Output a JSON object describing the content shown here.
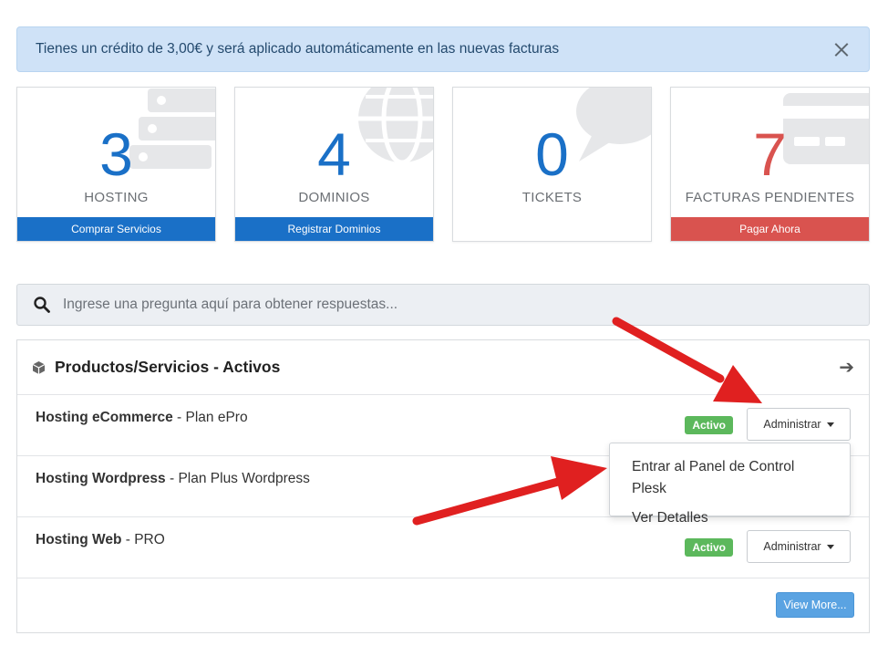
{
  "alert": {
    "text": "Tienes un crédito de 3,00€ y será aplicado automáticamente en las nuevas facturas"
  },
  "tiles": [
    {
      "number": "3",
      "label": "HOSTING",
      "footer": "Comprar Servicios",
      "icon": "server-icon"
    },
    {
      "number": "4",
      "label": "DOMINIOS",
      "footer": "Registrar Dominios",
      "icon": "globe-icon"
    },
    {
      "number": "0",
      "label": "TICKETS",
      "footer": "",
      "icon": "chat-bubble-icon"
    },
    {
      "number": "7",
      "label": "FACTURAS PENDIENTES",
      "footer": "Pagar Ahora",
      "icon": "credit-card-icon"
    }
  ],
  "search": {
    "placeholder": "Ingrese una pregunta aquí para obtener respuestas..."
  },
  "products": {
    "title": "Productos/Servicios - Activos",
    "rows": [
      {
        "product": "Hosting eCommerce",
        "plan": "- Plan ePro",
        "status": "Activo",
        "action": "Administrar"
      },
      {
        "product": "Hosting Wordpress",
        "plan": "- Plan Plus Wordpress",
        "status": "",
        "action": ""
      },
      {
        "product": "Hosting Web",
        "plan": "- PRO",
        "status": "Activo",
        "action": "Administrar"
      }
    ],
    "view_more": "View More..."
  },
  "dropdown": {
    "items": [
      "Entrar al Panel de Control Plesk",
      "Ver Detalles"
    ]
  },
  "colors": {
    "primary": "#1a70c7",
    "danger": "#d9534f",
    "success": "#5cb85c",
    "alert_bg": "#cfe2f7",
    "annotation_arrow": "#e02020"
  }
}
